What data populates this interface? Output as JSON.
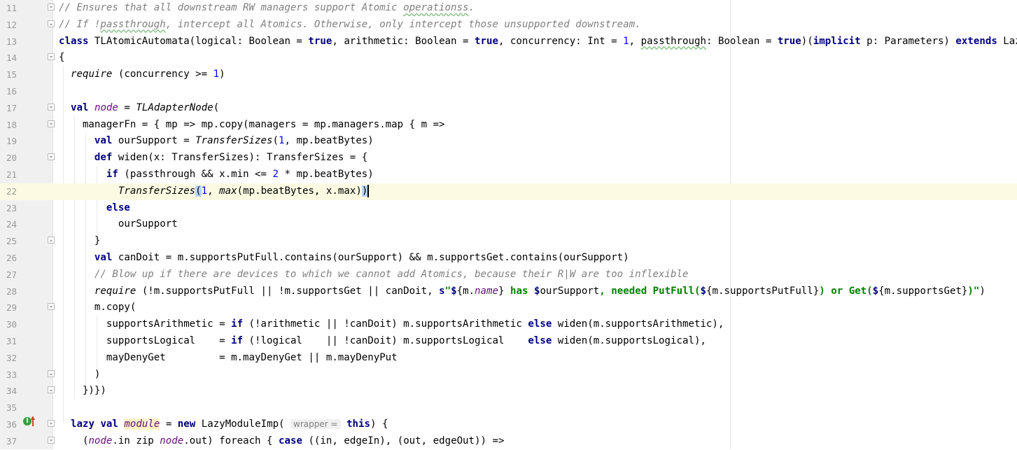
{
  "editor": {
    "current_line": 22,
    "param_hint": "wrapper =",
    "icons": [
      "implements-icon",
      "overrides-icon"
    ],
    "colors": {
      "keyword": "#000080",
      "number": "#0000ff",
      "comment": "#808080",
      "string": "#008000",
      "field": "#660e7a",
      "current_line_bg": "#fcfae3"
    }
  },
  "lines": [
    {
      "n": "11",
      "t": "// Ensures that all downstream RW managers support Atomic operationss."
    },
    {
      "n": "12",
      "t": "// If !passthrough, intercept all Atomics. Otherwise, only intercept those unsupported downstream."
    },
    {
      "n": "13",
      "t": "class TLAtomicAutomata(logical: Boolean = true, arithmetic: Boolean = true, concurrency: Int = 1, passthrough: Boolean = true)(implicit p: Parameters) extends LazyModule"
    },
    {
      "n": "14",
      "t": "{"
    },
    {
      "n": "15",
      "t": "  require (concurrency >= 1)"
    },
    {
      "n": "16",
      "t": ""
    },
    {
      "n": "17",
      "t": "  val node = TLAdapterNode("
    },
    {
      "n": "18",
      "t": "    managerFn = { mp => mp.copy(managers = mp.managers.map { m =>"
    },
    {
      "n": "19",
      "t": "      val ourSupport = TransferSizes(1, mp.beatBytes)"
    },
    {
      "n": "20",
      "t": "      def widen(x: TransferSizes): TransferSizes = {"
    },
    {
      "n": "21",
      "t": "        if (passthrough && x.min <= 2 * mp.beatBytes)"
    },
    {
      "n": "22",
      "t": "          TransferSizes(1, max(mp.beatBytes, x.max))"
    },
    {
      "n": "23",
      "t": "        else"
    },
    {
      "n": "24",
      "t": "          ourSupport"
    },
    {
      "n": "25",
      "t": "      }"
    },
    {
      "n": "26",
      "t": "      val canDoit = m.supportsPutFull.contains(ourSupport) && m.supportsGet.contains(ourSupport)"
    },
    {
      "n": "27",
      "t": "      // Blow up if there are devices to which we cannot add Atomics, because their R|W are too inflexible"
    },
    {
      "n": "28",
      "t": "      require (!m.supportsPutFull || !m.supportsGet || canDoit, s\"${m.name} has $ourSupport, needed PutFull(${m.supportsPutFull}) or Get(${m.supportsGet})\")"
    },
    {
      "n": "29",
      "t": "      m.copy("
    },
    {
      "n": "30",
      "t": "        supportsArithmetic = if (!arithmetic || !canDoit) m.supportsArithmetic else widen(m.supportsArithmetic),"
    },
    {
      "n": "31",
      "t": "        supportsLogical    = if (!logical    || !canDoit) m.supportsLogical    else widen(m.supportsLogical),"
    },
    {
      "n": "32",
      "t": "        mayDenyGet         = m.mayDenyGet || m.mayDenyPut"
    },
    {
      "n": "33",
      "t": "      )"
    },
    {
      "n": "34",
      "t": "    })})"
    },
    {
      "n": "35",
      "t": ""
    },
    {
      "n": "36",
      "t": "  lazy val module = new LazyModuleImp(wrapper = this) {"
    },
    {
      "n": "37",
      "t": "    (node.in zip node.out) foreach { case ((in, edgeIn), (out, edgeOut)) =>"
    }
  ]
}
